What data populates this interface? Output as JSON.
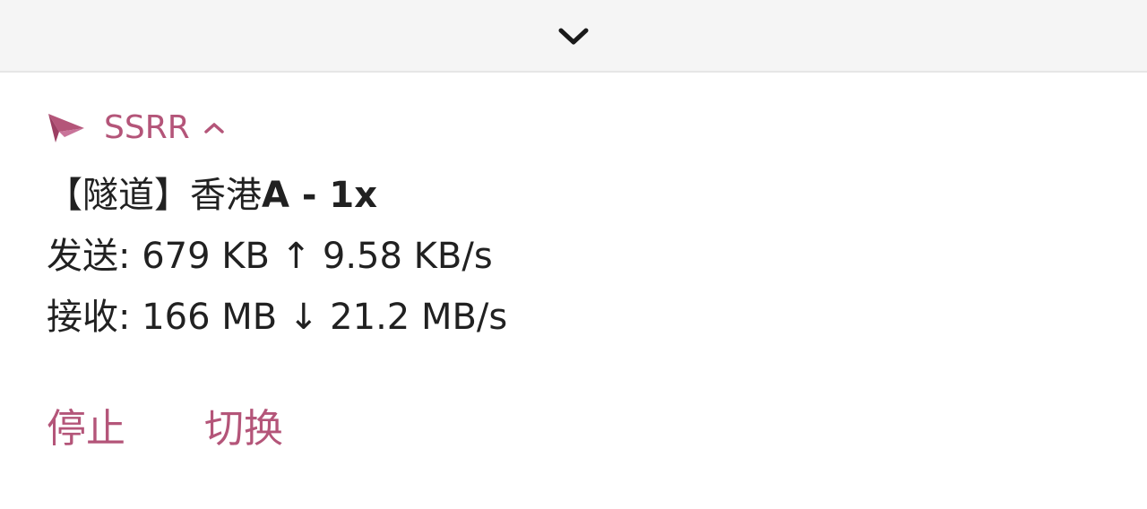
{
  "topbar": {
    "collapse_icon": "chevron-down-icon"
  },
  "notification": {
    "app_icon": "paper-plane-icon",
    "app_name": "SSRR",
    "expand_icon": "chevron-up-icon",
    "accent_color": "#b45579",
    "title_prefix": "【隧道】香港",
    "title_suffix": "A - 1x",
    "sent_label": "发送:",
    "sent_total": "679 KB",
    "sent_arrow": "↑",
    "sent_speed": "9.58 KB/s",
    "recv_label": "接收:",
    "recv_total": "166 MB",
    "recv_arrow": "↓",
    "recv_speed": "21.2 MB/s",
    "actions": {
      "stop_label": "停止",
      "switch_label": "切换"
    }
  }
}
